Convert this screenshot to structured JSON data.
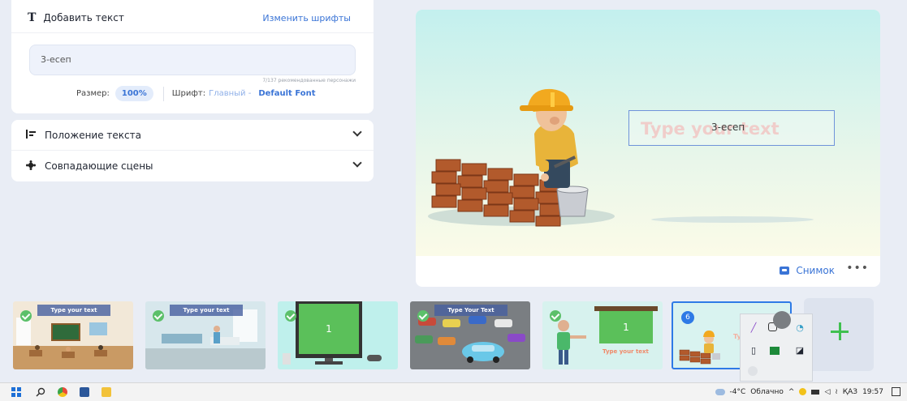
{
  "text_panel": {
    "title": "Добавить текст",
    "change_fonts": "Изменить шрифты",
    "text_value": "3-есеп",
    "char_count": "7/137 рекомендованные персонажи",
    "size_label": "Размер:",
    "size_value": "100%",
    "font_label": "Шрифт:",
    "font_type": "Главный -",
    "font_name": "Default Font"
  },
  "accordion": [
    {
      "label": "Положение текста",
      "icon": "align-icon"
    },
    {
      "label": "Совпадающие сцены",
      "icon": "scenes-icon"
    }
  ],
  "preview": {
    "ghost_text": "Type your text",
    "typed_text": "3-есеп",
    "snapshot_label": "Снимок",
    "more_label": "•••"
  },
  "scenes": [
    {
      "banner": "Type your text",
      "checked": true
    },
    {
      "banner": "Type your text",
      "checked": true
    },
    {
      "screen_number": "1",
      "checked": true
    },
    {
      "banner": "Type Your Text",
      "checked": true
    },
    {
      "screen_number": "1",
      "caption": "Type your text",
      "checked": true
    },
    {
      "number": "6",
      "selected": true
    }
  ],
  "taskbar": {
    "temperature": "-4°C",
    "weather": "Облачно",
    "language": "ҚАЗ",
    "time": "19:57"
  },
  "colors": {
    "accent": "#3a74d6",
    "green": "#5cc06a",
    "selected_border": "#2e7ae6"
  }
}
